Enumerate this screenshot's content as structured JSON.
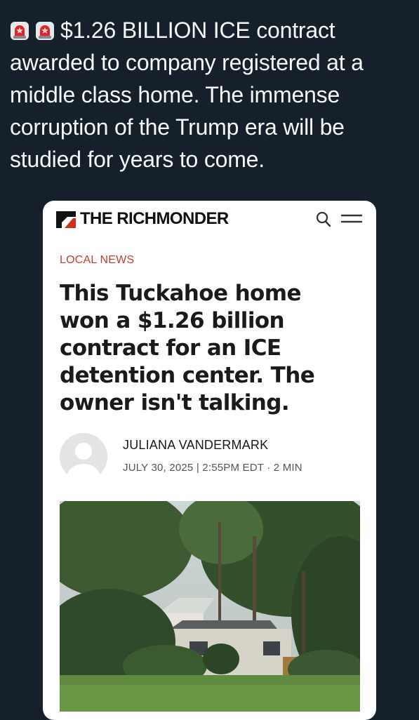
{
  "tweet": {
    "text": "$1.26 BILLION ICE contract awarded to company registered at a middle class home. The immense corruption of the Trump era will be studied for years to come.",
    "emoji": [
      "police-car-light-icon",
      "police-car-light-icon"
    ]
  },
  "article_card": {
    "publication": "THE RICHMONDER",
    "kicker": "LOCAL NEWS",
    "headline": "This Tuckahoe home won a $1.26 billion contract for an ICE detention center. The owner isn't talking.",
    "author": "JULIANA VANDERMARK",
    "meta": "JULY 30, 2025 | 2:55PM EDT · 2 MIN",
    "icons": [
      "search-icon",
      "menu-icon",
      "avatar-placeholder-icon"
    ]
  },
  "colors": {
    "background": "#15202b",
    "card": "#ffffff",
    "kicker": "#c2412f",
    "logo_accent": "#d0311f"
  }
}
